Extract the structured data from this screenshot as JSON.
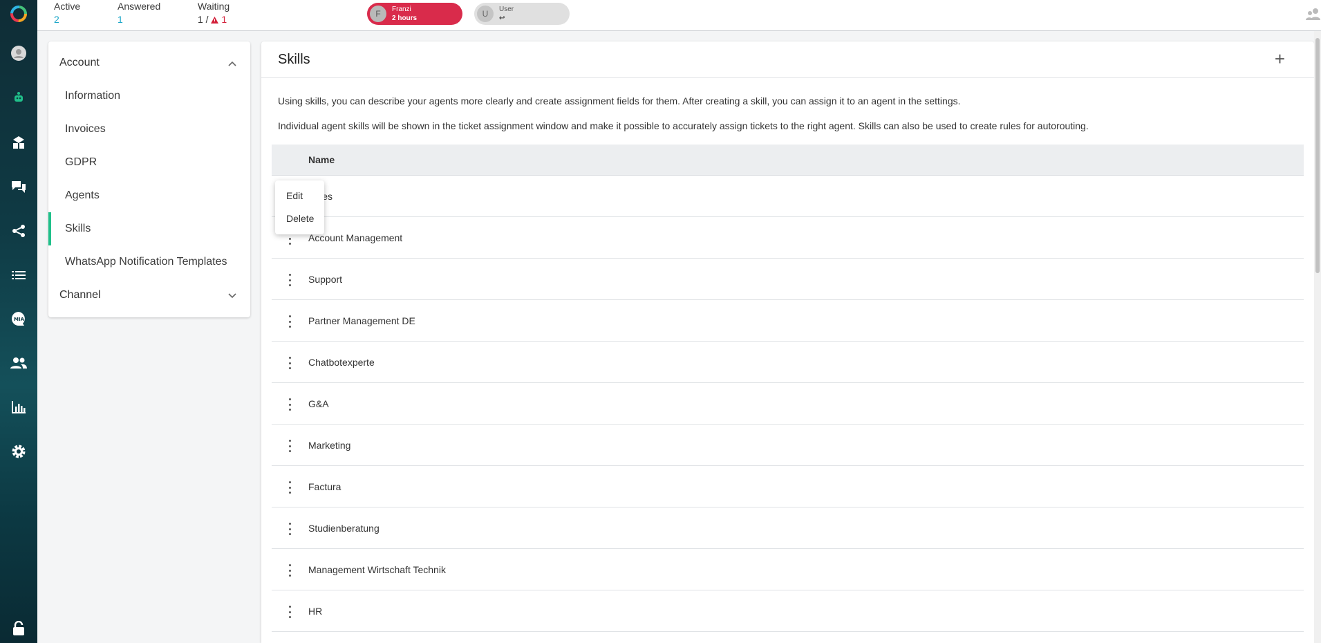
{
  "stats": {
    "active_label": "Active",
    "active_value": "2",
    "answered_label": "Answered",
    "answered_value": "1",
    "waiting_label": "Waiting",
    "waiting_value": "1 /",
    "waiting_alert": "1"
  },
  "pills": [
    {
      "initial": "F",
      "name": "Franzi",
      "detail": "2 hours"
    },
    {
      "initial": "U",
      "name": "User",
      "detail": "↩"
    }
  ],
  "menu": {
    "account_label": "Account",
    "items": [
      "Information",
      "Invoices",
      "GDPR",
      "Agents",
      "Skills",
      "WhatsApp Notification Templates"
    ],
    "active_item": "Skills",
    "channel_label": "Channel"
  },
  "panel": {
    "title": "Skills",
    "add_label": "+",
    "desc1": "Using skills, you can describe your agents more clearly and create assignment fields for them. After creating a skill, you can assign it to an agent in the settings.",
    "desc2": "Individual agent skills will be shown in the ticket assignment window and make it possible to accurately assign tickets to the right agent. Skills can also be used to create rules for autorouting.",
    "column_name": "Name",
    "rows": [
      "Sales",
      "Account Management",
      "Support",
      "Partner Management DE",
      "Chatbotexperte",
      "G&A",
      "Marketing",
      "Factura",
      "Studienberatung",
      "Management Wirtschaft Technik",
      "HR"
    ]
  },
  "context_menu": {
    "edit": "Edit",
    "delete": "Delete"
  },
  "colors": {
    "accent": "#20c08a",
    "alert": "#d92b4b",
    "link": "#1aa6c8"
  }
}
